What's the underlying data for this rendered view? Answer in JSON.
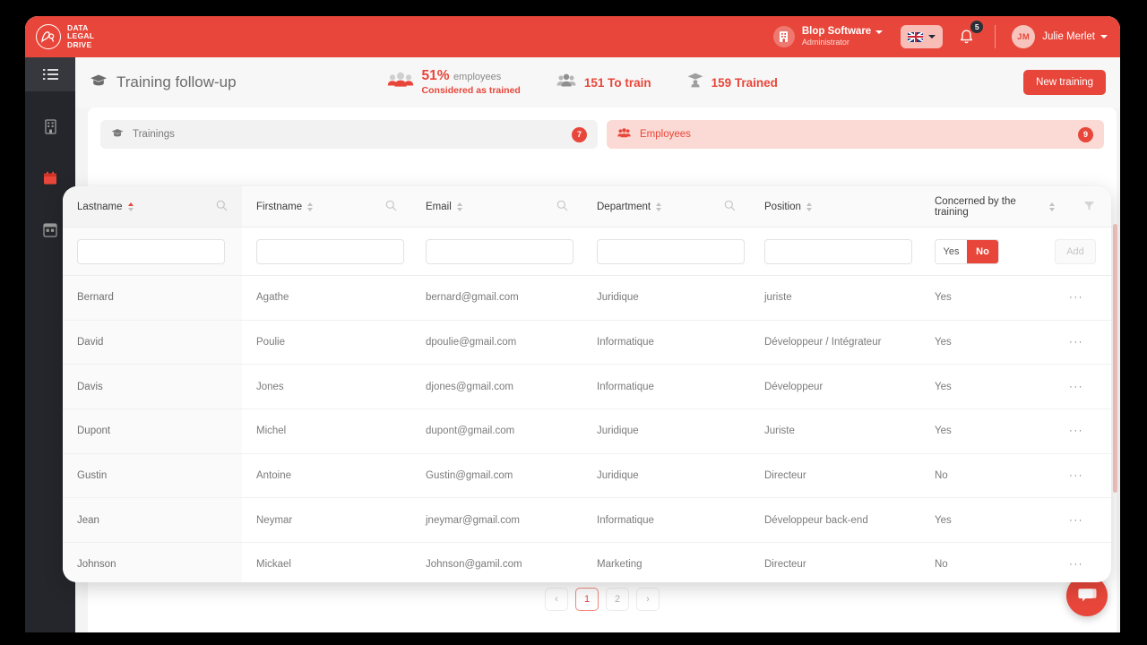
{
  "brand": {
    "logo_lines": [
      "DATA",
      "LEGAL",
      "DRIVE"
    ],
    "accent_color": "#e8463a",
    "header_bg": "#e8463a",
    "sidebar_bg": "#25262b"
  },
  "topbar": {
    "org_name": "Blop Software",
    "org_role": "Administrator",
    "language": "en-GB",
    "notification_count": "5",
    "user_initials": "JM",
    "user_name": "Julie Merlet"
  },
  "sidebar": {
    "items": [
      {
        "name": "menu-collapse",
        "icon": "list-menu-icon",
        "active": true
      },
      {
        "name": "company",
        "icon": "building-icon",
        "active": false
      },
      {
        "name": "calendar",
        "icon": "calendar-icon",
        "active": false
      },
      {
        "name": "dashboard",
        "icon": "grid-icon",
        "active": false
      }
    ]
  },
  "page": {
    "title": "Training follow-up",
    "title_icon": "graduation-cap-icon",
    "new_button": "New training"
  },
  "stats": [
    {
      "icon": "people-group-icon",
      "value": "51",
      "unit": "%",
      "label": "employees",
      "sublabel": "Considered as trained"
    },
    {
      "icon": "users-icon",
      "text": "151 To train"
    },
    {
      "icon": "graduate-icon",
      "text": "159 Trained"
    }
  ],
  "tabs": [
    {
      "label": "Trainings",
      "icon": "graduation-cap-icon",
      "badge": "7",
      "active": false
    },
    {
      "label": "Employees",
      "icon": "users-icon",
      "badge": "9",
      "active": true
    }
  ],
  "table": {
    "columns": [
      {
        "label": "Lastname",
        "sortable": true,
        "sorted": "asc",
        "searchable": true
      },
      {
        "label": "Firstname",
        "sortable": true,
        "sorted": "none",
        "searchable": true
      },
      {
        "label": "Email",
        "sortable": true,
        "sorted": "none",
        "searchable": true
      },
      {
        "label": "Department",
        "sortable": true,
        "sorted": "none",
        "searchable": true
      },
      {
        "label": "Position",
        "sortable": true,
        "sorted": "none",
        "searchable": false
      },
      {
        "label": "Concerned by the training",
        "sortable": true,
        "sorted": "none",
        "filterable": true
      },
      {
        "label": "",
        "sortable": false
      }
    ],
    "filters": {
      "lastname": "",
      "firstname": "",
      "email": "",
      "department": "",
      "position": "",
      "concerned_yes": "Yes",
      "concerned_no": "No",
      "concerned_selected": "No",
      "add_button": "Add"
    },
    "rows": [
      {
        "lastname": "Bernard",
        "firstname": "Agathe",
        "email": "bernard@gmail.com",
        "department": "Juridique",
        "position": "juriste",
        "concerned": "Yes",
        "actions": "···"
      },
      {
        "lastname": "David",
        "firstname": "Poulie",
        "email": "dpoulie@gmail.com",
        "department": "Informatique",
        "position": "Développeur / Intégrateur",
        "concerned": "Yes",
        "actions": "···"
      },
      {
        "lastname": "Davis",
        "firstname": "Jones",
        "email": "djones@gmail.com",
        "department": "Informatique",
        "position": "Développeur",
        "concerned": "Yes",
        "actions": "···"
      },
      {
        "lastname": "Dupont",
        "firstname": "Michel",
        "email": "dupont@gmail.com",
        "department": "Juridique",
        "position": "Juriste",
        "concerned": "Yes",
        "actions": "···"
      },
      {
        "lastname": "Gustin",
        "firstname": "Antoine",
        "email": "Gustin@gmail.com",
        "department": "Juridique",
        "position": "Directeur",
        "concerned": "No",
        "actions": "···"
      },
      {
        "lastname": "Jean",
        "firstname": "Neymar",
        "email": "jneymar@gmail.com",
        "department": "Informatique",
        "position": "Développeur back-end",
        "concerned": "Yes",
        "actions": "···"
      },
      {
        "lastname": "Johnson",
        "firstname": "Mickael",
        "email": "Johnson@gamil.com",
        "department": "Marketing",
        "position": "Directeur",
        "concerned": "No",
        "actions": "···"
      }
    ]
  },
  "pagination": {
    "prev": "‹",
    "pages": [
      "1",
      "2"
    ],
    "current": "1",
    "next": "›"
  },
  "chat_widget": {
    "icon": "chat-bubble-icon"
  }
}
